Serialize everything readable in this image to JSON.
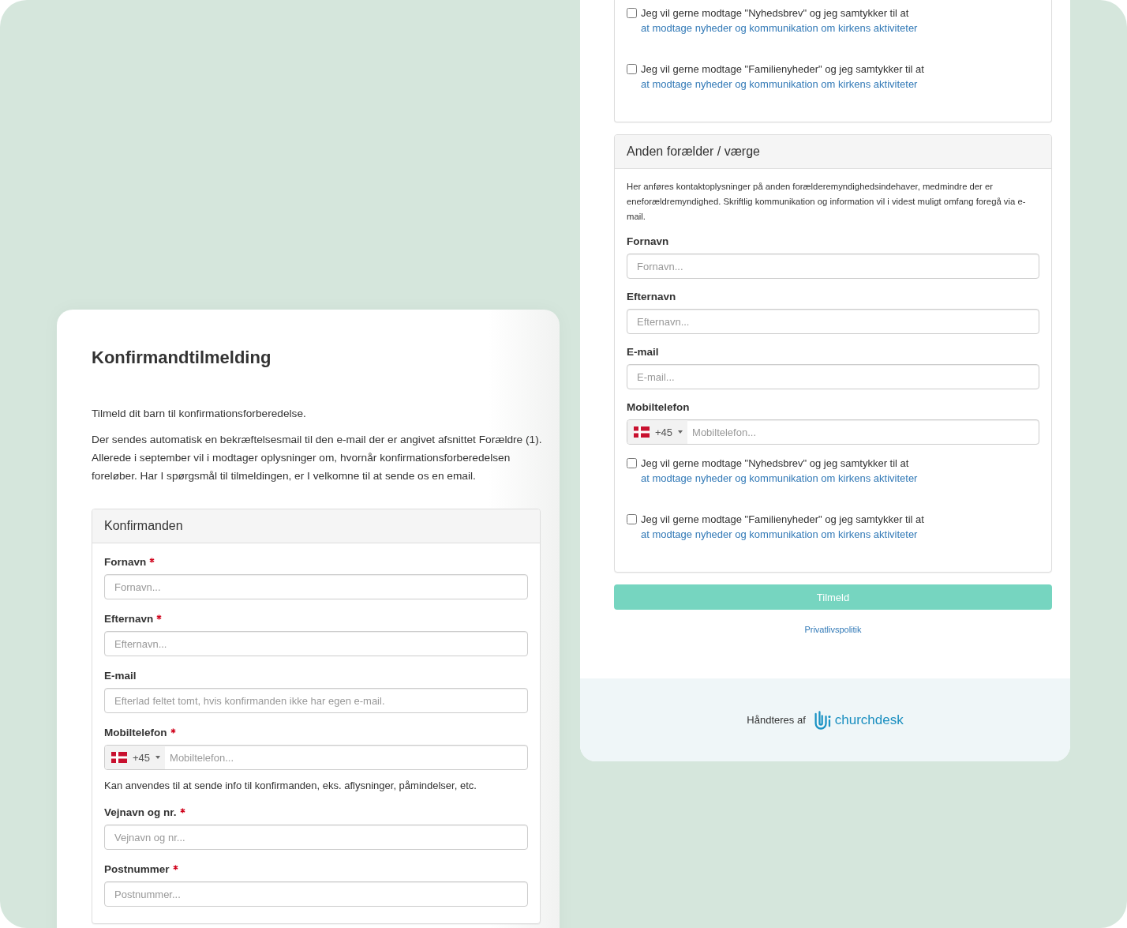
{
  "left_card": {
    "title": "Konfirmandtilmelding",
    "intro": [
      "Tilmeld dit barn til konfirmationsforberedelse.",
      "Der sendes automatisk en bekræftelsesmail til den e-mail der er angivet afsnittet Forældre (1). Allerede i september vil i modtager oplysninger om, hvornår konfirmationsforberedelsen foreløber. Har I spørgsmål til tilmeldingen, er I velkomne til at sende os en email."
    ],
    "sections": [
      {
        "title": "Konfirmanden",
        "fields": [
          {
            "kind": "text",
            "label": "Fornavn",
            "required": true,
            "placeholder": "Fornavn..."
          },
          {
            "kind": "text",
            "label": "Efternavn",
            "required": true,
            "placeholder": "Efternavn..."
          },
          {
            "kind": "text",
            "label": "E-mail",
            "required": false,
            "placeholder": "Efterlad feltet tomt, hvis konfirmanden ikke har egen e-mail."
          },
          {
            "kind": "phone",
            "label": "Mobiltelefon",
            "required": true,
            "dial_code": "+45",
            "placeholder": "Mobiltelefon...",
            "help": "Kan anvendes til at sende info til konfirmanden, eks. aflysninger, påmindelser, etc."
          },
          {
            "kind": "text",
            "label": "Vejnavn og nr.",
            "required": true,
            "placeholder": "Vejnavn og nr..."
          },
          {
            "kind": "text",
            "label": "Postnummer",
            "required": true,
            "placeholder": "Postnummer..."
          }
        ]
      }
    ]
  },
  "right_card": {
    "sections": [
      {
        "consents": [
          {
            "checked": false,
            "text": "Jeg vil gerne modtage \"Nyhedsbrev\" og jeg samtykker til at",
            "link": "at modtage nyheder og kommunikation om kirkens aktiviteter"
          },
          {
            "checked": false,
            "text": "Jeg vil gerne modtage \"Familienyheder\" og jeg samtykker til at",
            "link": "at modtage nyheder og kommunikation om kirkens aktiviteter"
          }
        ]
      },
      {
        "title": "Anden forælder / værge",
        "description": "Her anføres kontaktoplysninger på anden forælderemyndighedsindehaver, medmindre der er eneforældremyndighed. Skriftlig kommunikation og information vil i videst muligt omfang foregå via e-mail.",
        "fields": [
          {
            "kind": "text",
            "label": "Fornavn",
            "required": false,
            "placeholder": "Fornavn..."
          },
          {
            "kind": "text",
            "label": "Efternavn",
            "required": false,
            "placeholder": "Efternavn..."
          },
          {
            "kind": "text",
            "label": "E-mail",
            "required": false,
            "placeholder": "E-mail..."
          },
          {
            "kind": "phone",
            "label": "Mobiltelefon",
            "required": false,
            "dial_code": "+45",
            "placeholder": "Mobiltelefon..."
          }
        ],
        "consents": [
          {
            "checked": false,
            "text": "Jeg vil gerne modtage \"Nyhedsbrev\" og jeg samtykker til at",
            "link": "at modtage nyheder og kommunikation om kirkens aktiviteter"
          },
          {
            "checked": false,
            "text": "Jeg vil gerne modtage \"Familienyheder\" og jeg samtykker til at",
            "link": "at modtage nyheder og kommunikation om kirkens aktiviteter"
          }
        ]
      }
    ],
    "submit_button": "Tilmeld",
    "privacy_link": "Privatlivspolitik",
    "footer": {
      "text": "Håndteres af",
      "brand": "churchdesk"
    }
  }
}
